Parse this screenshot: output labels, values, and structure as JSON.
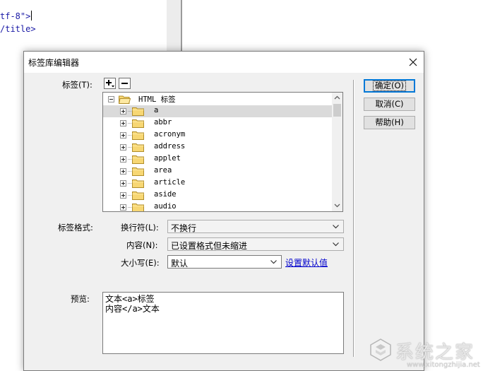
{
  "editor": {
    "code_line_1": "tf-8\">",
    "code_line_2": "/title>"
  },
  "dialog": {
    "title": "标签库编辑器",
    "tags_label": "标签(T):",
    "tag_format_label": "标签格式:",
    "linebreak_label": "换行符(L):",
    "content_label": "内容(N):",
    "case_label": "大小写(E):",
    "preview_label": "预览:"
  },
  "tree": {
    "root": "HTML 标签",
    "items": [
      "a",
      "abbr",
      "acronym",
      "address",
      "applet",
      "area",
      "article",
      "aside",
      "audio"
    ],
    "selected_index": 0
  },
  "selects": {
    "linebreak": "不换行",
    "content": "已设置格式但未缩进",
    "case": "默认"
  },
  "links": {
    "set_default": "设置默认值"
  },
  "preview": {
    "line1": "文本<a>标签",
    "line2": "内容</a>文本"
  },
  "buttons": {
    "ok": "确定(O)",
    "cancel": "取消(C)",
    "help": "帮助(H)"
  },
  "watermark": {
    "text": "系统之家",
    "url": "www.xitongzhijia.net"
  },
  "colors": {
    "dialog_bg": "#f0f0f0",
    "selection": "#dadada",
    "default_button_border": "#0078d7",
    "link": "#0000cc",
    "folder_yellow": "#f7d774"
  }
}
